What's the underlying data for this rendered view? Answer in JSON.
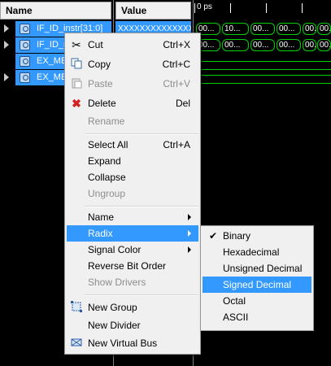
{
  "header": {
    "name_label": "Name",
    "value_label": "Value",
    "time_label": "0 ps"
  },
  "signals": [
    {
      "name": "IF_ID_instr[31:0]",
      "value": "XXXXXXXXXXXXXXXX",
      "expandable": true
    },
    {
      "name": "IF_ID_r",
      "value": "",
      "expandable": true
    },
    {
      "name": "EX_ME",
      "value": "",
      "expandable": false
    },
    {
      "name": "EX_ME",
      "value": "",
      "expandable": true
    }
  ],
  "waves": {
    "row1": [
      "00...",
      "10...",
      "00...",
      "00...",
      "00...",
      "00..."
    ],
    "row2": [
      "00...",
      "00...",
      "00...",
      "00...",
      "00...",
      "00..."
    ]
  },
  "context_menu": {
    "cut": {
      "label": "Cut",
      "shortcut": "Ctrl+X",
      "icon": "scissors-icon"
    },
    "copy": {
      "label": "Copy",
      "shortcut": "Ctrl+C",
      "icon": "copy-icon"
    },
    "paste": {
      "label": "Paste",
      "shortcut": "Ctrl+V",
      "icon": "paste-icon"
    },
    "delete": {
      "label": "Delete",
      "shortcut": "Del",
      "icon": "delete-x-icon"
    },
    "rename": {
      "label": "Rename"
    },
    "select_all": {
      "label": "Select All",
      "shortcut": "Ctrl+A"
    },
    "expand": {
      "label": "Expand"
    },
    "collapse": {
      "label": "Collapse"
    },
    "ungroup": {
      "label": "Ungroup"
    },
    "name": {
      "label": "Name"
    },
    "radix": {
      "label": "Radix"
    },
    "signal_color": {
      "label": "Signal Color"
    },
    "reverse_bit_order": {
      "label": "Reverse Bit Order"
    },
    "show_drivers": {
      "label": "Show Drivers"
    },
    "new_group": {
      "label": "New Group",
      "icon": "new-group-icon"
    },
    "new_divider": {
      "label": "New Divider"
    },
    "new_virtual_bus": {
      "label": "New Virtual Bus",
      "icon": "virtual-bus-icon"
    }
  },
  "radix_submenu": {
    "binary": "Binary",
    "hexadecimal": "Hexadecimal",
    "unsigned_decimal": "Unsigned Decimal",
    "signed_decimal": "Signed Decimal",
    "octal": "Octal",
    "ascii": "ASCII",
    "checked": "Binary",
    "highlighted": "Signed Decimal"
  },
  "colors": {
    "selection": "#3399ff",
    "wave": "#00d000",
    "background": "#000000",
    "menu_bg": "#f0f0f0"
  }
}
